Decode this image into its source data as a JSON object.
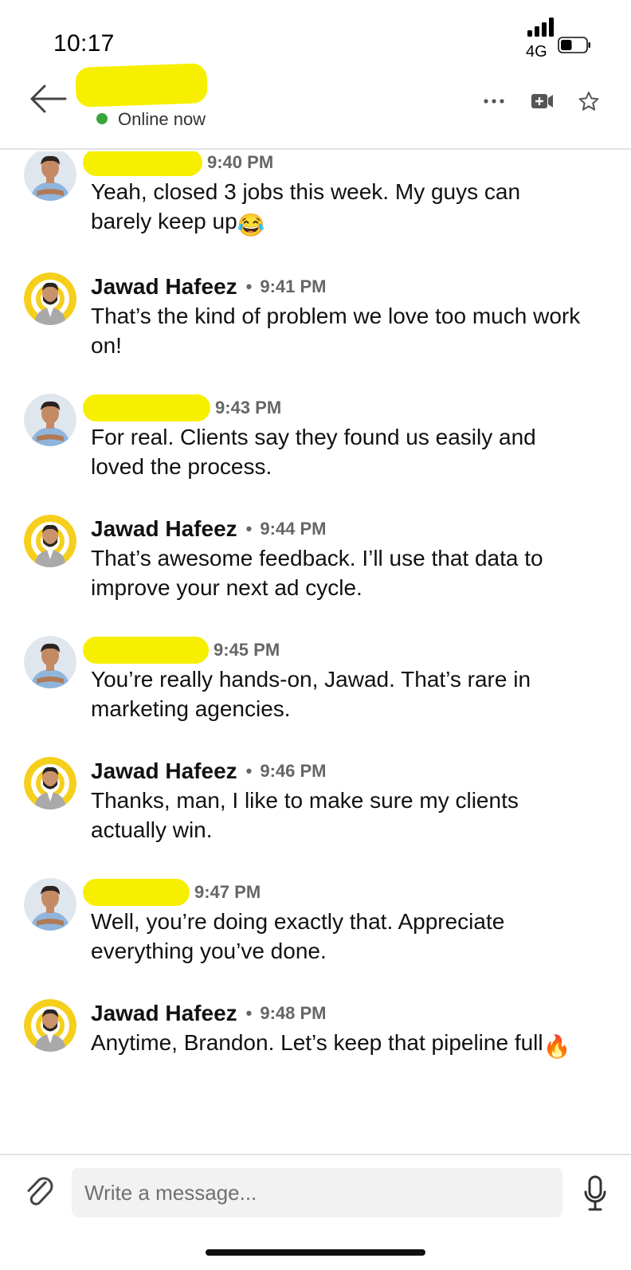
{
  "status": {
    "time": "10:17",
    "network": "4G",
    "signal_bars": 4,
    "battery_level": 0.45
  },
  "header": {
    "contact_name_redacted": true,
    "presence": "Online now",
    "presence_color": "#3aa53a",
    "icons": [
      "back-arrow-icon",
      "more-icon",
      "video-call-icon",
      "star-icon"
    ]
  },
  "messages": [
    {
      "sender": "",
      "sender_redacted": true,
      "avatar": "contact",
      "time": "9:40 PM",
      "text": "Yeah, closed 3 jobs this week. My guys can barely keep up",
      "emoji": "😂"
    },
    {
      "sender": "Jawad Hafeez",
      "sender_redacted": false,
      "avatar": "jawad",
      "time": "9:41 PM",
      "text": "That’s the kind of problem we love too much work on!"
    },
    {
      "sender": "",
      "sender_redacted": true,
      "avatar": "contact",
      "time": "9:43 PM",
      "text": "For real. Clients say they found us easily and loved the process."
    },
    {
      "sender": "Jawad Hafeez",
      "sender_redacted": false,
      "avatar": "jawad",
      "time": "9:44 PM",
      "text": "That’s awesome feedback. I’ll use that data to improve your next ad cycle."
    },
    {
      "sender": "",
      "sender_redacted": true,
      "avatar": "contact",
      "time": "9:45 PM",
      "text": "You’re really hands-on, Jawad. That’s rare in marketing agencies."
    },
    {
      "sender": "Jawad Hafeez",
      "sender_redacted": false,
      "avatar": "jawad",
      "time": "9:46 PM",
      "text": "Thanks, man, I like to make sure my clients actually win."
    },
    {
      "sender": "",
      "sender_redacted": true,
      "avatar": "contact",
      "time": "9:47 PM",
      "text": "Well, you’re doing exactly that. Appreciate everything you’ve done."
    },
    {
      "sender": "Jawad Hafeez",
      "sender_redacted": false,
      "avatar": "jawad",
      "time": "9:48 PM",
      "text": "Anytime, Brandon. Let’s keep that pipeline full",
      "emoji": "🔥"
    }
  ],
  "composer": {
    "placeholder": "Write a message...",
    "value": "",
    "icons": [
      "paperclip-icon",
      "microphone-icon"
    ]
  },
  "colors": {
    "redaction": "#f7ef00",
    "avatar_ring": "#f5cf1c",
    "divider": "#e3e3e3"
  }
}
